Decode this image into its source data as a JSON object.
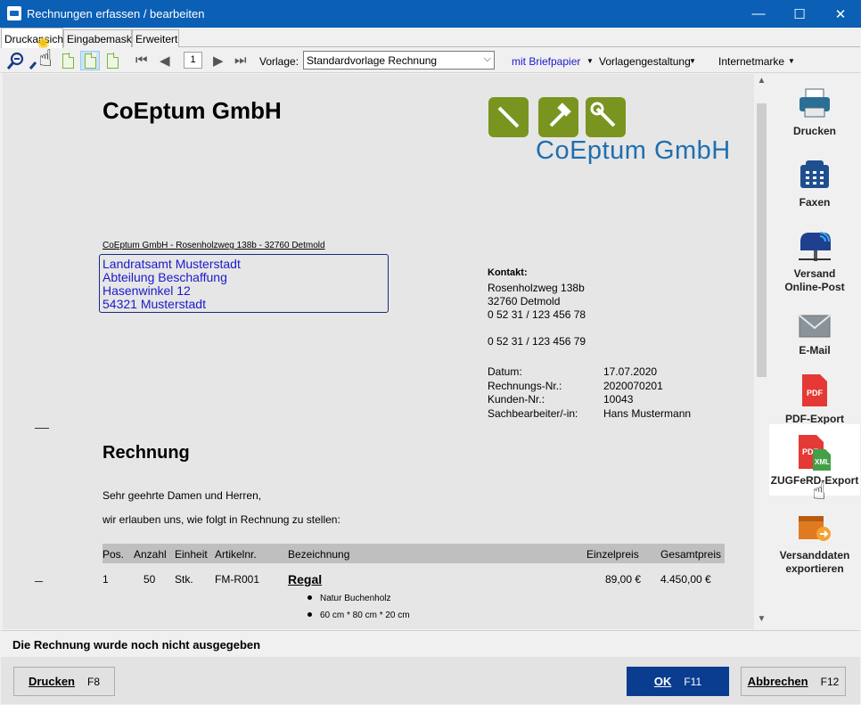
{
  "window": {
    "title": "Rechnungen erfassen / bearbeiten",
    "minimize": "—",
    "maximize": "☐",
    "close": "✕"
  },
  "tabs": [
    {
      "label": "Druckansicht"
    },
    {
      "label": "Eingabemaske"
    },
    {
      "label": "Erweitert"
    }
  ],
  "toolbar": {
    "page_number": "1",
    "vorlage_label": "Vorlage:",
    "vorlage_value": "Standardvorlage Rechnung",
    "briefpapier": "mit Briefpapier",
    "vorlagengestaltung": "Vorlagengestaltung",
    "internetmarke": "Internetmarke"
  },
  "document": {
    "company_name": "CoEptum GmbH",
    "logo_text": "CoEptum GmbH",
    "sender_line": "CoEptum GmbH - Rosenholzweg 138b - 32760 Detmold",
    "recipient": [
      "Landratsamt Musterstadt",
      "Abteilung Beschaffung",
      "Hasenwinkel 12",
      "54321 Musterstadt"
    ],
    "contact": {
      "label": "Kontakt:",
      "street": "Rosenholzweg 138b",
      "city": "32760 Detmold",
      "phone": "0 52 31 / 123 456 78",
      "fax": "0 52 31 / 123 456 79"
    },
    "meta": [
      {
        "label": "Datum:",
        "value": "17.07.2020"
      },
      {
        "label": "Rechnungs-Nr.:",
        "value": "2020070201"
      },
      {
        "label": "Kunden-Nr.:",
        "value": "10043"
      },
      {
        "label": "Sachbearbeiter/-in:",
        "value": "Hans Mustermann"
      }
    ],
    "heading": "Rechnung",
    "greeting": "Sehr geehrte Damen und Herren,",
    "intro": "wir erlauben uns, wie folgt in Rechnung zu stellen:",
    "table": {
      "headers": [
        "Pos.",
        "Anzahl",
        "Einheit",
        "Artikelnr.",
        "Bezeichnung",
        "Einzelpreis",
        "Gesamtpreis"
      ],
      "rows": [
        {
          "pos": "1",
          "anzahl": "50",
          "einheit": "Stk.",
          "artikelnr": "FM-R001",
          "bezeichnung": "Regal",
          "einzelpreis": "89,00 €",
          "gesamtpreis": "4.450,00 €",
          "details": [
            "Natur Buchenholz",
            "60 cm * 80 cm * 20 cm"
          ]
        }
      ]
    }
  },
  "sidebar": [
    {
      "label": "Drucken",
      "icon": "printer-icon"
    },
    {
      "label": "Faxen",
      "icon": "fax-icon"
    },
    {
      "label": "Versand\nOnline-Post",
      "icon": "mailbox-icon"
    },
    {
      "label": "E-Mail",
      "icon": "envelope-icon"
    },
    {
      "label": "PDF-Export",
      "icon": "pdf-icon"
    },
    {
      "label": "ZUGFeRD-Export",
      "icon": "zugferd-icon"
    },
    {
      "label": "Versanddaten\nexportieren",
      "icon": "shipping-export-icon"
    }
  ],
  "status": {
    "text": "Die Rechnung wurde noch nicht ausgegeben"
  },
  "buttons": {
    "print": {
      "label": "Drucken",
      "key": "F8"
    },
    "ok": {
      "label": "OK",
      "key": "F11"
    },
    "cancel": {
      "label": "Abbrechen",
      "key": "F12"
    }
  },
  "colors": {
    "titlebar": "#0b5fb5",
    "logo_green": "#7a9420",
    "logo_blue": "#1f6fb0",
    "address_blue": "#1a1acc",
    "ok_button": "#0a3d8f"
  }
}
